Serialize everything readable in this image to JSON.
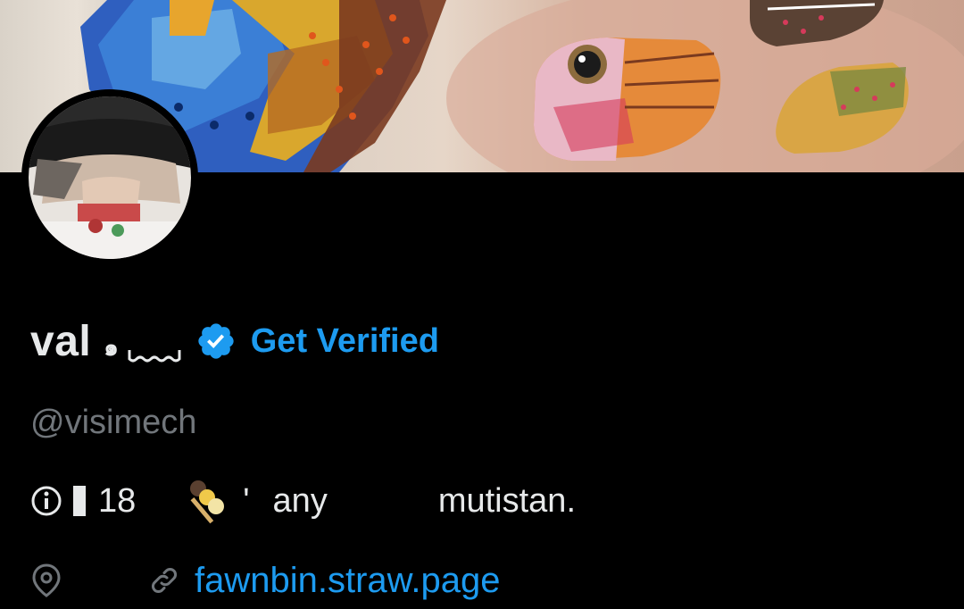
{
  "profile": {
    "display_name": "val",
    "name_decoration": "๑",
    "get_verified_label": "Get Verified",
    "handle": "@visimech",
    "bio": {
      "age": "18",
      "part1": "'",
      "part2": "any",
      "part3": "mutistan."
    },
    "link": "fawnbin.straw.page"
  },
  "icons": {
    "verified": "verified-badge-icon",
    "info": "info-circle-icon",
    "location": "location-pin-icon",
    "link": "link-icon",
    "dango": "dango-emoji"
  },
  "colors": {
    "accent": "#1d9bf0",
    "muted": "#71767b",
    "text": "#e7e9ea",
    "background": "#000000"
  }
}
